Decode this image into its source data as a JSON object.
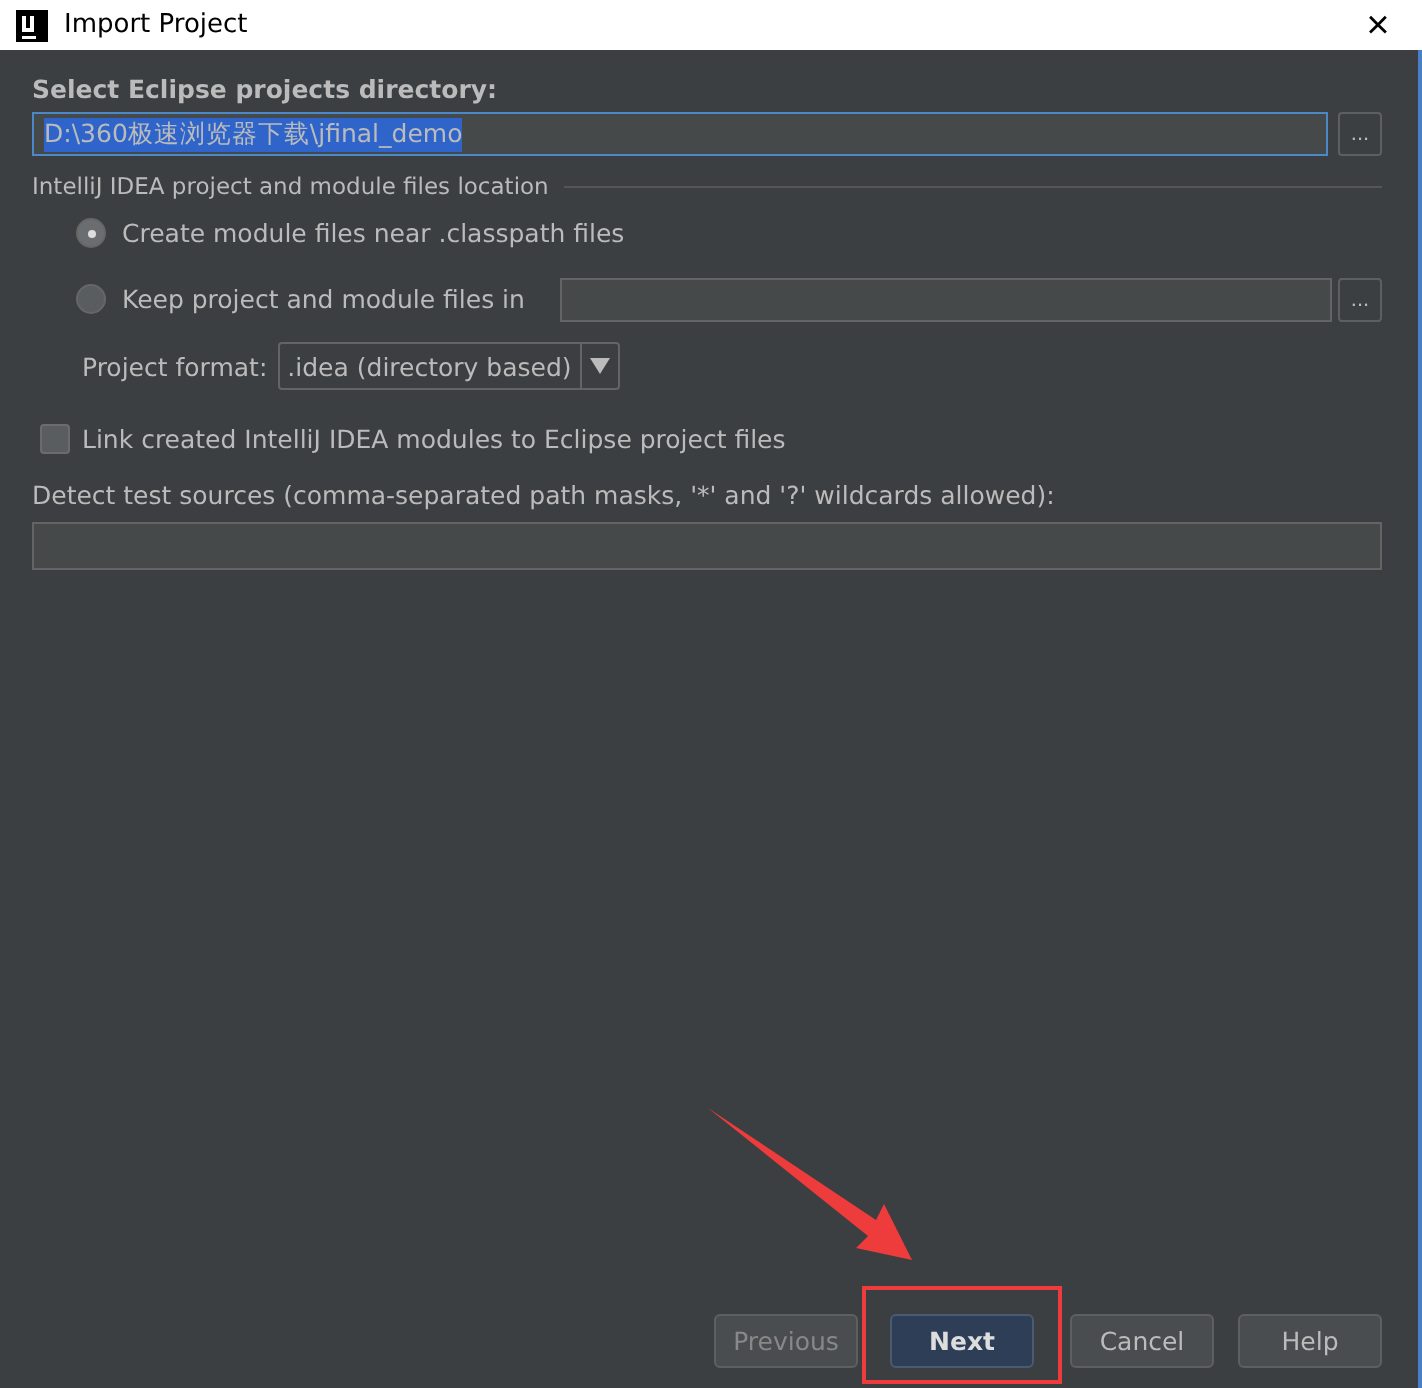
{
  "window": {
    "title": "Import Project",
    "close": "×"
  },
  "directory": {
    "label": "Select Eclipse projects directory:",
    "value": "D:\\360极速浏览器下载\\jfinal_demo",
    "text_selected": true,
    "browse": "..."
  },
  "location": {
    "title": "IntelliJ IDEA project and module files location",
    "options": [
      {
        "label": "Create module files near .classpath files",
        "selected": true
      },
      {
        "label": "Keep project and module files in",
        "selected": false
      }
    ],
    "browse": "...",
    "format": {
      "label": "Project format:",
      "value": ".idea (directory based)"
    }
  },
  "link_checkbox": {
    "label": "Link created IntelliJ IDEA modules to Eclipse project files",
    "checked": false
  },
  "test_sources": {
    "label": "Detect test sources (comma-separated path masks, '*' and '?' wildcards allowed):"
  },
  "buttons": [
    {
      "label": "Previous",
      "disabled": true,
      "default": false,
      "highlighted": false
    },
    {
      "label": "Next",
      "disabled": false,
      "default": true,
      "highlighted": true
    },
    {
      "label": "Cancel",
      "disabled": false,
      "default": false,
      "highlighted": false
    },
    {
      "label": "Help",
      "disabled": false,
      "default": false,
      "highlighted": false
    }
  ]
}
